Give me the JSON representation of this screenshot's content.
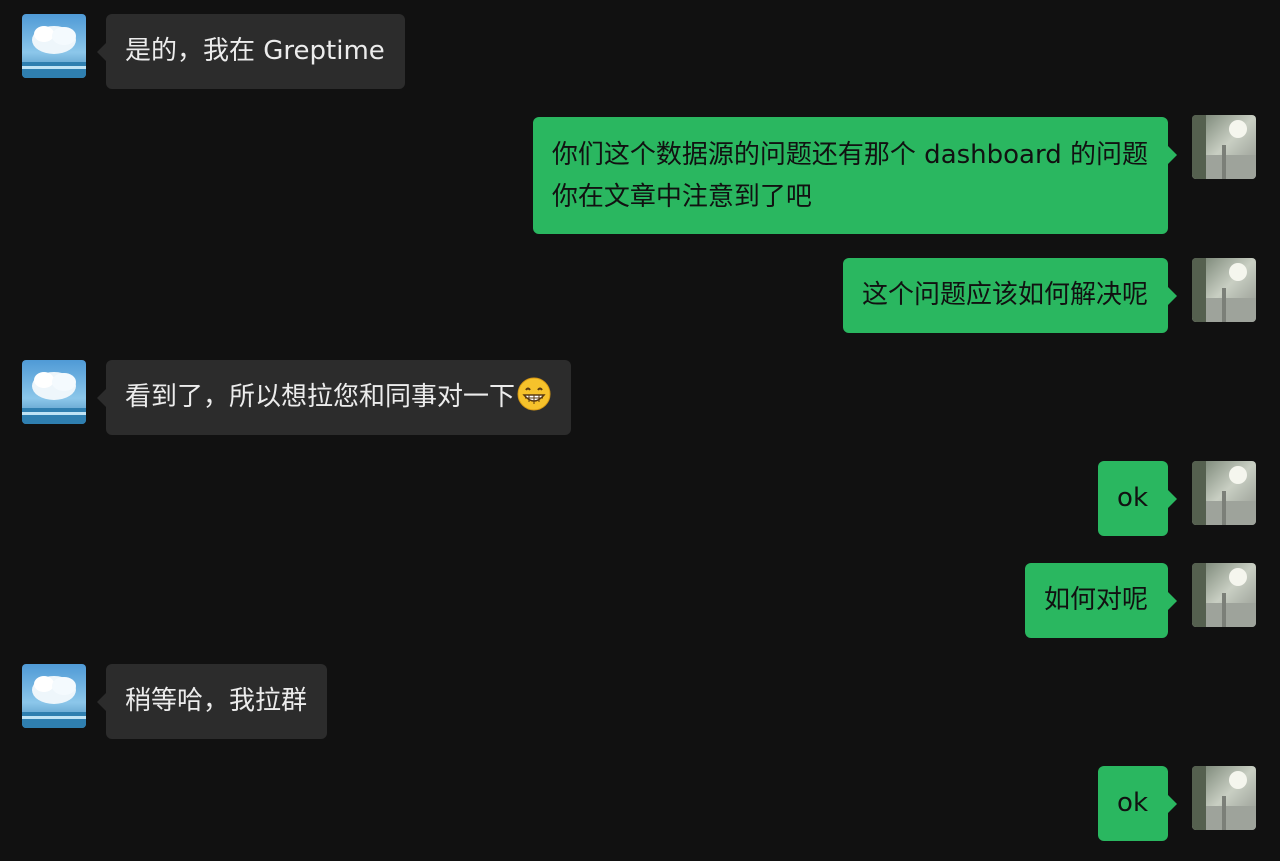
{
  "chat": {
    "contact_avatar_icon": "landscape-avatar-icon",
    "self_avatar_icon": "photo-avatar-icon",
    "messages": [
      {
        "side": "left",
        "text": "是的，我在 Greptime"
      },
      {
        "side": "right",
        "lines": [
          "你们这个数据源的问题还有那个 dashboard 的问题",
          "你在文章中注意到了吧"
        ]
      },
      {
        "side": "right",
        "text": "这个问题应该如何解决呢"
      },
      {
        "side": "left",
        "text": "看到了，所以想拉您和同事对一下",
        "emoji": "grinning-face-icon"
      },
      {
        "side": "right",
        "text": "ok"
      },
      {
        "side": "right",
        "text": "如何对呢"
      },
      {
        "side": "left",
        "text": "稍等哈，我拉群"
      },
      {
        "side": "right",
        "text": "ok"
      }
    ]
  },
  "colors": {
    "background": "#111111",
    "incoming_bubble": "#2c2c2c",
    "outgoing_bubble": "#2ab760"
  }
}
